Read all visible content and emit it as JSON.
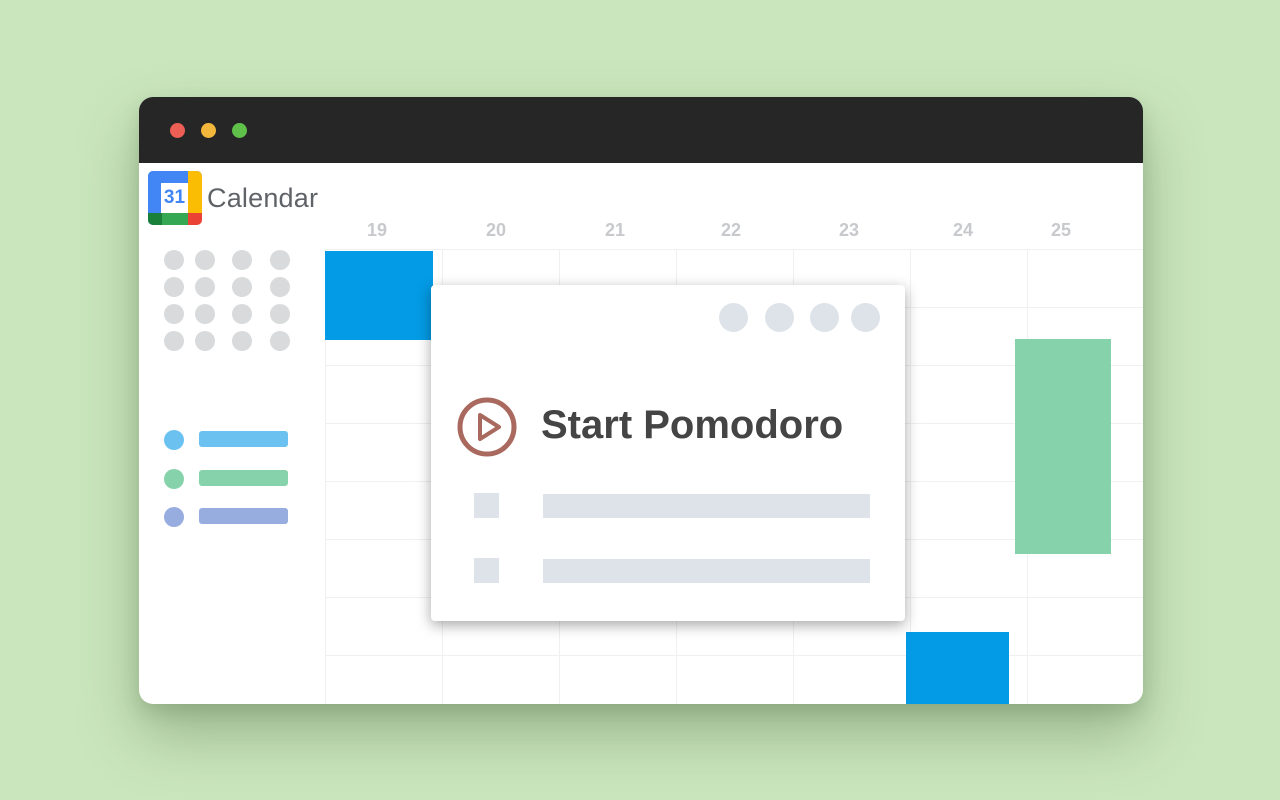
{
  "app": {
    "name": "Calendar",
    "logo_number": "31"
  },
  "calendar": {
    "days": [
      "19",
      "20",
      "21",
      "22",
      "23",
      "24",
      "25"
    ],
    "calendar_colors": [
      "#6bc1ef",
      "#86d3ab",
      "#97acdf"
    ]
  },
  "event_colors": {
    "blue": "#039be5",
    "green": "#86d3ab"
  },
  "dialog": {
    "title": "Start Pomodoro",
    "icon": "play-circle-icon",
    "icon_color": "#a9695e"
  }
}
